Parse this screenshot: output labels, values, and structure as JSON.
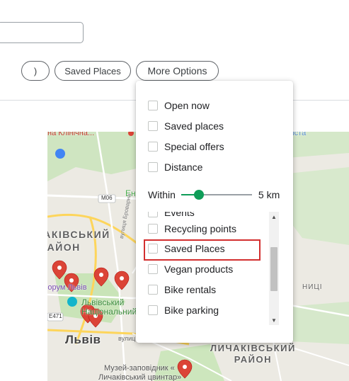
{
  "search": {
    "value": ""
  },
  "chips": {
    "partial_label": ")",
    "saved_places_label": "Saved Places",
    "more_options_label": "More Options"
  },
  "dropdown": {
    "top_options": [
      {
        "label": "Open now",
        "checked": false
      },
      {
        "label": "Saved places",
        "checked": false
      },
      {
        "label": "Special offers",
        "checked": false
      },
      {
        "label": "Distance",
        "checked": false
      }
    ],
    "within": {
      "label": "Within",
      "value_label": "5 km",
      "level_fraction": 0.25
    },
    "list_options": [
      {
        "label": "Events",
        "checked": false
      },
      {
        "label": "Recycling points",
        "checked": false
      },
      {
        "label": "Saved Places",
        "checked": false,
        "highlighted": true
      },
      {
        "label": "Vegan products",
        "checked": false
      },
      {
        "label": "Bike rentals",
        "checked": false
      },
      {
        "label": "Bike parking",
        "checked": false
      }
    ]
  },
  "map": {
    "labels": {
      "district_1_line1": "ЛИЧАКІВСЬКИЙ",
      "district_1_line2": "РАЙОН",
      "district_2_line1": "ЛИЧАКІВСЬКИЙ",
      "district_2_line2": "РАЙОН",
      "city": "Львів",
      "park_partial": "на Клінічна...",
      "forum": "Форум Львів",
      "park_name_1": "Львівський",
      "park_name_2": "Національний",
      "museum_1": "Музей-заповідник «",
      "museum_2": "Личаківський цвинтар»",
      "road_m06": "M06",
      "road_e471": "E471",
      "area_eni": "Ені",
      "street_vulych": "вулиц",
      "place_nytsi": "НИЦІ",
      "place_styst": "стиста",
      "street_vertical": "вулиця Броварна"
    },
    "colors": {
      "pin": "#db4437",
      "park": "#c8e6b8",
      "road": "#fdd55b",
      "land": "#eceae3"
    }
  }
}
